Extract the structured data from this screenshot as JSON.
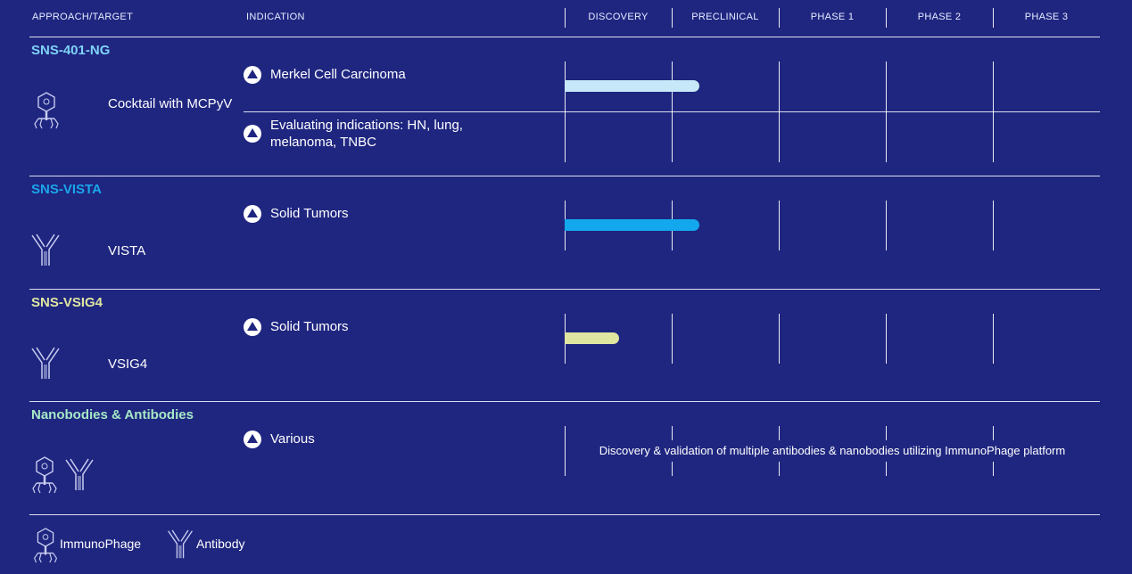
{
  "header": {
    "approach_target": "APPROACH/TARGET",
    "indication": "INDICATION",
    "phases": [
      "DISCOVERY",
      "PRECLINICAL",
      "PHASE 1",
      "PHASE 2",
      "PHASE 3"
    ]
  },
  "programs": [
    {
      "name": "SNS-401-NG",
      "name_color": "#7fd3f7",
      "target": "Cocktail with MCPyV",
      "target_icon": "immunophage-icon",
      "indications": [
        {
          "label": "Merkel Cell Carcinoma",
          "bar_color": "#c6e8f8",
          "progress_phases": 1.25
        },
        {
          "label": "Evaluating indications: HN, lung, melanoma, TNBC",
          "bar_color": "",
          "progress_phases": 0
        }
      ]
    },
    {
      "name": "SNS-VISTA",
      "name_color": "#1aa6ea",
      "target": "VISTA",
      "target_icon": "antibody-icon",
      "indications": [
        {
          "label": "Solid Tumors",
          "bar_color": "#13a8ee",
          "progress_phases": 1.25
        }
      ]
    },
    {
      "name": "SNS-VSIG4",
      "name_color": "#dfe6a0",
      "target": "VSIG4",
      "target_icon": "antibody-icon",
      "indications": [
        {
          "label": "Solid Tumors",
          "bar_color": "#dfe6a0",
          "progress_phases": 0.5
        }
      ]
    },
    {
      "name": "Nanobodies & Antibodies",
      "name_color": "#a6e8c6",
      "target": "",
      "target_icon": "immunophage-and-antibody-icons",
      "indications": [
        {
          "label": "Various",
          "bar_color": "",
          "progress_phases": 0
        }
      ],
      "note": "Discovery & validation of multiple antibodies & nanobodies utilizing ImmunoPhage platform"
    }
  ],
  "legend": [
    {
      "label": "ImmunoPhage",
      "icon": "immunophage-icon"
    },
    {
      "label": "Antibody",
      "icon": "antibody-icon"
    }
  ]
}
